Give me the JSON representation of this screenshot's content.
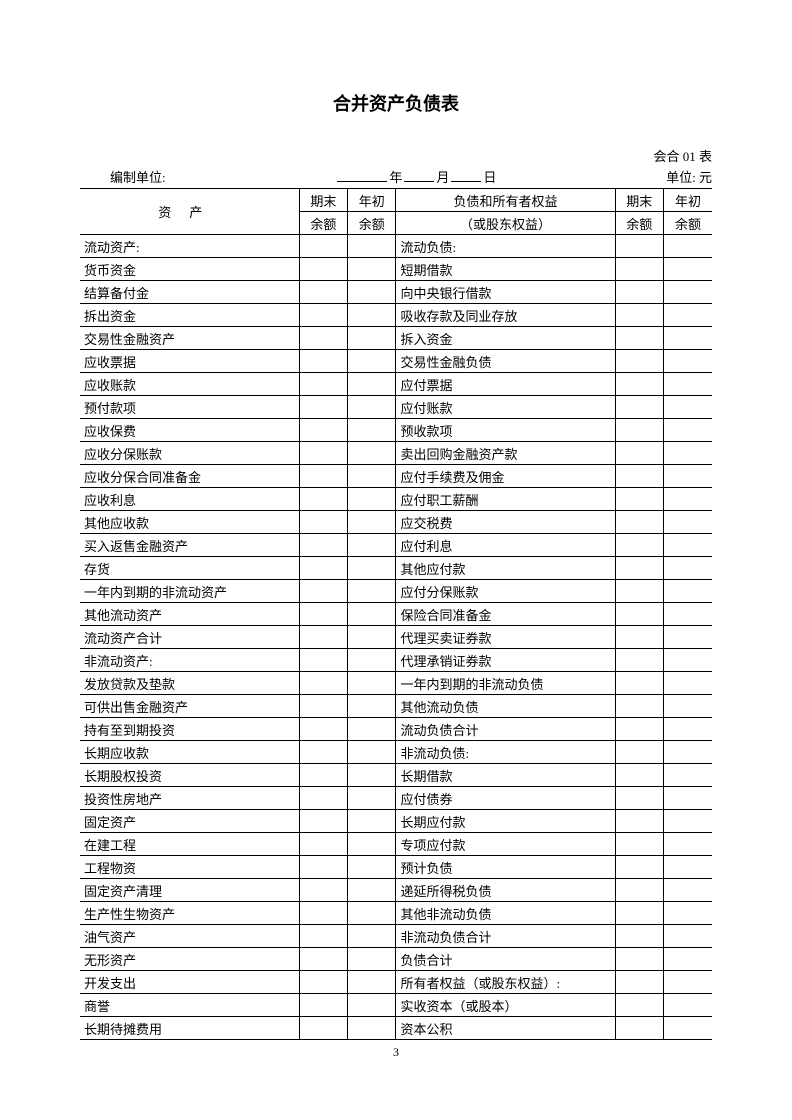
{
  "title": "合并资产负债表",
  "form_no": "会合 01 表",
  "meta": {
    "org_label": "编制单位:",
    "year_label": "年",
    "month_label": "月",
    "day_label": "日",
    "unit_label": "单位: 元"
  },
  "header": {
    "assets_label": "资产",
    "end_bal": "期末",
    "end_bal2": "余额",
    "beg_bal": "年初",
    "beg_bal2": "余额",
    "liab_label1": "负债和所有者权益",
    "liab_label2": "（或股东权益）"
  },
  "rows": [
    {
      "a": "流动资产:",
      "ai": 0,
      "l": "流动负债:",
      "li": 0
    },
    {
      "a": "货币资金",
      "ai": 1,
      "l": "短期借款",
      "li": 1
    },
    {
      "a": "结算备付金",
      "ai": 1,
      "l": "向中央银行借款",
      "li": 1
    },
    {
      "a": "拆出资金",
      "ai": 1,
      "l": "吸收存款及同业存放",
      "li": 1
    },
    {
      "a": "交易性金融资产",
      "ai": 1,
      "l": "拆入资金",
      "li": 1
    },
    {
      "a": "应收票据",
      "ai": 1,
      "l": "交易性金融负债",
      "li": 1
    },
    {
      "a": "应收账款",
      "ai": 1,
      "l": "应付票据",
      "li": 1
    },
    {
      "a": "预付款项",
      "ai": 1,
      "l": "应付账款",
      "li": 1
    },
    {
      "a": "应收保费",
      "ai": 1,
      "l": "预收款项",
      "li": 1
    },
    {
      "a": "应收分保账款",
      "ai": 1,
      "l": "卖出回购金融资产款",
      "li": 1
    },
    {
      "a": "应收分保合同准备金",
      "ai": 1,
      "l": "应付手续费及佣金",
      "li": 1
    },
    {
      "a": "应收利息",
      "ai": 1,
      "l": "应付职工薪酬",
      "li": 1
    },
    {
      "a": "其他应收款",
      "ai": 1,
      "l": "应交税费",
      "li": 1
    },
    {
      "a": "买入返售金融资产",
      "ai": 1,
      "l": "应付利息",
      "li": 1
    },
    {
      "a": "存货",
      "ai": 1,
      "l": "其他应付款",
      "li": 1
    },
    {
      "a": "一年内到期的非流动资产",
      "ai": 1,
      "l": "应付分保账款",
      "li": 1
    },
    {
      "a": "其他流动资产",
      "ai": 1,
      "l": "保险合同准备金",
      "li": 1
    },
    {
      "a": "流动资产合计",
      "ai": 2,
      "l": "代理买卖证券款",
      "li": 1
    },
    {
      "a": "非流动资产:",
      "ai": 0,
      "l": "代理承销证券款",
      "li": 1
    },
    {
      "a": "发放贷款及垫款",
      "ai": 1,
      "l": "一年内到期的非流动负债",
      "li": 1
    },
    {
      "a": "可供出售金融资产",
      "ai": 1,
      "l": "其他流动负债",
      "li": 1
    },
    {
      "a": "持有至到期投资",
      "ai": 1,
      "l": "流动负债合计",
      "li": 2
    },
    {
      "a": "长期应收款",
      "ai": 1,
      "l": "非流动负债:",
      "li": 0
    },
    {
      "a": "长期股权投资",
      "ai": 1,
      "l": "长期借款",
      "li": 1
    },
    {
      "a": "投资性房地产",
      "ai": 1,
      "l": "应付债券",
      "li": 1
    },
    {
      "a": "固定资产",
      "ai": 1,
      "l": "长期应付款",
      "li": 1
    },
    {
      "a": "在建工程",
      "ai": 1,
      "l": "专项应付款",
      "li": 1
    },
    {
      "a": "工程物资",
      "ai": 1,
      "l": "预计负债",
      "li": 1
    },
    {
      "a": "固定资产清理",
      "ai": 1,
      "l": "递延所得税负债",
      "li": 1
    },
    {
      "a": "生产性生物资产",
      "ai": 1,
      "l": "其他非流动负债",
      "li": 1
    },
    {
      "a": "油气资产",
      "ai": 1,
      "l": "非流动负债合计",
      "li": 2
    },
    {
      "a": "无形资产",
      "ai": 1,
      "l": "负债合计",
      "li": 2
    },
    {
      "a": "开发支出",
      "ai": 1,
      "l": "所有者权益（或股东权益）:",
      "li": 0
    },
    {
      "a": "商誉",
      "ai": 1,
      "l": "实收资本（或股本）",
      "li": 1
    },
    {
      "a": "长期待摊费用",
      "ai": 1,
      "l": "资本公积",
      "li": 1
    }
  ],
  "page_number": "3"
}
